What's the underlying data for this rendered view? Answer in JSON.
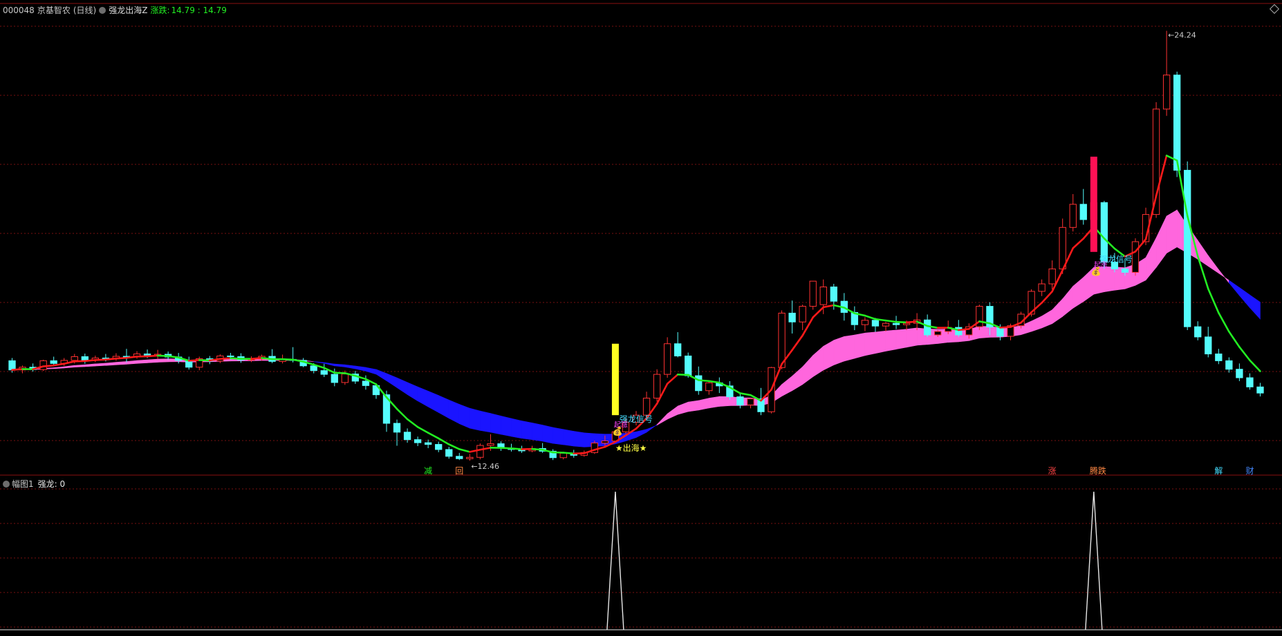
{
  "header": {
    "stock_code": "000048",
    "stock_name": "京基智农",
    "period": "(日线)",
    "indicator_name": "强龙出海Z",
    "change_label": "涨跌:",
    "change_value": "14.79 : 14.79"
  },
  "sub_panel": {
    "title": "幅图1",
    "indicator_label": "强龙: 0"
  },
  "annotations": {
    "high_price": "24.24",
    "low_price": "12.46",
    "signal_1": "强龙信号",
    "signal_2": "强龙信号",
    "tag_1": "起涨",
    "tag_2": "起涨",
    "chuhai": "★出海★",
    "bottom_tags": [
      "减",
      "回",
      "涨",
      "腾跌",
      "解",
      "财"
    ]
  },
  "colors": {
    "up": "#ff3232",
    "down": "#54fcfc",
    "ribbon_bull": "#ff66dd",
    "ribbon_bear": "#1a14ff",
    "ma_up": "#ff1a1a",
    "ma_down": "#22ee22",
    "grid": "#7a0f0f",
    "yellow_bar": "#ffff22",
    "red_bar": "#ff1155"
  },
  "chart_data": {
    "type": "candlestick",
    "x_count": 121,
    "price_range": [
      11.5,
      24.9
    ],
    "candles": [
      [
        14.7,
        14.78,
        14.43,
        14.35
      ],
      [
        14.43,
        14.56,
        14.51,
        14.33
      ],
      [
        14.51,
        14.62,
        14.44,
        14.38
      ],
      [
        14.44,
        14.73,
        14.7,
        14.4
      ],
      [
        14.7,
        14.82,
        14.62,
        14.54
      ],
      [
        14.62,
        14.78,
        14.71,
        14.55
      ],
      [
        14.71,
        14.9,
        14.82,
        14.62
      ],
      [
        14.82,
        14.91,
        14.71,
        14.61
      ],
      [
        14.71,
        14.85,
        14.78,
        14.66
      ],
      [
        14.78,
        14.9,
        14.76,
        14.68
      ],
      [
        14.76,
        14.92,
        14.83,
        14.7
      ],
      [
        14.83,
        15.05,
        14.82,
        14.65
      ],
      [
        14.82,
        14.98,
        14.9,
        14.76
      ],
      [
        14.9,
        15.03,
        14.85,
        14.78
      ],
      [
        14.85,
        15.02,
        14.89,
        14.76
      ],
      [
        14.89,
        14.97,
        14.81,
        14.72
      ],
      [
        14.81,
        14.93,
        14.71,
        14.62
      ],
      [
        14.71,
        14.82,
        14.51,
        14.44
      ],
      [
        14.51,
        14.82,
        14.76,
        14.42
      ],
      [
        14.76,
        14.84,
        14.69,
        14.6
      ],
      [
        14.69,
        14.89,
        14.84,
        14.63
      ],
      [
        14.84,
        14.93,
        14.82,
        14.73
      ],
      [
        14.82,
        14.92,
        14.72,
        14.64
      ],
      [
        14.72,
        14.83,
        14.75,
        14.66
      ],
      [
        14.75,
        14.88,
        14.83,
        14.7
      ],
      [
        14.83,
        15.04,
        14.68,
        14.63
      ],
      [
        14.68,
        14.88,
        14.74,
        14.62
      ],
      [
        14.74,
        15.1,
        14.71,
        14.65
      ],
      [
        14.71,
        14.78,
        14.55,
        14.51
      ],
      [
        14.55,
        14.63,
        14.41,
        14.33
      ],
      [
        14.41,
        14.61,
        14.3,
        14.22
      ],
      [
        14.3,
        14.47,
        14.06,
        13.95
      ],
      [
        14.06,
        14.41,
        14.31,
        13.99
      ],
      [
        14.31,
        14.4,
        14.1,
        14.02
      ],
      [
        14.1,
        14.27,
        13.97,
        13.85
      ],
      [
        13.97,
        14.04,
        13.7,
        13.58
      ],
      [
        13.7,
        13.82,
        12.86,
        12.61
      ],
      [
        12.86,
        12.97,
        12.6,
        12.2
      ],
      [
        12.6,
        12.71,
        12.38,
        12.29
      ],
      [
        12.38,
        12.47,
        12.29,
        12.19
      ],
      [
        12.29,
        12.38,
        12.24,
        12.13
      ],
      [
        12.24,
        12.32,
        12.09,
        12.01
      ],
      [
        12.09,
        12.17,
        11.89,
        11.82
      ],
      [
        11.89,
        11.99,
        11.82,
        11.78
      ],
      [
        11.82,
        11.96,
        11.86,
        11.76
      ],
      [
        11.86,
        12.27,
        12.21,
        11.8
      ],
      [
        12.21,
        12.54,
        12.26,
        12.05
      ],
      [
        12.26,
        12.33,
        12.13,
        12.05
      ],
      [
        12.13,
        12.26,
        12.09,
        12.03
      ],
      [
        12.09,
        12.2,
        12.05,
        11.99
      ],
      [
        12.05,
        12.2,
        12.12,
        12.01
      ],
      [
        12.12,
        12.28,
        12.04,
        11.99
      ],
      [
        12.04,
        12.1,
        11.85,
        11.78
      ],
      [
        11.85,
        12.02,
        11.98,
        11.8
      ],
      [
        11.98,
        12.08,
        11.92,
        11.85
      ],
      [
        11.92,
        12.06,
        12.0,
        11.88
      ],
      [
        12.0,
        12.35,
        12.28,
        11.96
      ],
      [
        12.28,
        12.5,
        12.34,
        12.2
      ],
      [
        12.34,
        12.66,
        12.61,
        12.3
      ],
      [
        12.61,
        13.0,
        12.89,
        12.55
      ],
      [
        12.89,
        13.22,
        13.1,
        12.8
      ],
      [
        13.1,
        13.79,
        13.6,
        13.0
      ],
      [
        13.6,
        14.45,
        14.3,
        13.5
      ],
      [
        14.3,
        15.39,
        15.2,
        14.2
      ],
      [
        15.2,
        15.54,
        14.84,
        14.8
      ],
      [
        14.84,
        14.94,
        14.26,
        14.2
      ],
      [
        14.26,
        14.53,
        13.82,
        13.7
      ],
      [
        13.82,
        14.1,
        14.05,
        13.7
      ],
      [
        14.05,
        14.21,
        13.96,
        13.75
      ],
      [
        13.96,
        14.1,
        13.64,
        13.55
      ],
      [
        13.64,
        13.75,
        13.4,
        13.3
      ],
      [
        13.4,
        13.6,
        13.58,
        13.3
      ],
      [
        13.58,
        13.9,
        13.2,
        13.1
      ],
      [
        13.2,
        14.52,
        14.5,
        13.15
      ],
      [
        14.5,
        16.18,
        16.1,
        14.45
      ],
      [
        16.1,
        16.47,
        15.84,
        15.5
      ],
      [
        15.84,
        16.35,
        16.3,
        15.6
      ],
      [
        16.3,
        16.65,
        17.04,
        16.2
      ],
      [
        16.35,
        17.09,
        16.87,
        16.07
      ],
      [
        16.87,
        16.96,
        16.45,
        16.2
      ],
      [
        16.45,
        16.69,
        16.12,
        15.88
      ],
      [
        16.12,
        16.3,
        15.76,
        15.6
      ],
      [
        15.76,
        15.98,
        15.89,
        15.57
      ],
      [
        15.89,
        15.96,
        15.72,
        15.55
      ],
      [
        15.72,
        15.84,
        15.8,
        15.56
      ],
      [
        15.8,
        16.02,
        15.76,
        15.63
      ],
      [
        15.76,
        15.88,
        15.8,
        15.6
      ],
      [
        15.8,
        16.1,
        15.9,
        15.6
      ],
      [
        15.9,
        16.06,
        15.46,
        15.4
      ],
      [
        15.46,
        15.6,
        15.56,
        15.4
      ],
      [
        15.56,
        15.88,
        15.68,
        15.48
      ],
      [
        15.68,
        15.9,
        15.46,
        15.4
      ],
      [
        15.46,
        15.8,
        15.7,
        15.35
      ],
      [
        15.7,
        16.35,
        16.3,
        15.6
      ],
      [
        16.3,
        16.42,
        15.69,
        15.45
      ],
      [
        15.69,
        15.77,
        15.42,
        15.3
      ],
      [
        15.42,
        15.79,
        15.73,
        15.3
      ],
      [
        15.73,
        16.14,
        16.07,
        15.65
      ],
      [
        16.07,
        16.8,
        16.74,
        16.0
      ],
      [
        16.74,
        17.09,
        16.96,
        16.6
      ],
      [
        16.96,
        17.65,
        17.4,
        16.8
      ],
      [
        17.4,
        18.88,
        18.62,
        17.25
      ],
      [
        18.62,
        19.6,
        19.3,
        18.5
      ],
      [
        19.3,
        19.75,
        18.85,
        18.7
      ],
      [
        18.85,
        19.46,
        19.35,
        18.7
      ],
      [
        19.35,
        19.4,
        17.6,
        17.4
      ],
      [
        17.6,
        17.87,
        17.4,
        17.3
      ],
      [
        17.4,
        17.7,
        17.3,
        17.2
      ],
      [
        17.3,
        18.3,
        18.2,
        17.2
      ],
      [
        18.2,
        19.2,
        19.0,
        18.1
      ],
      [
        19.0,
        22.3,
        22.1,
        18.9
      ],
      [
        22.1,
        24.4,
        23.1,
        21.9
      ],
      [
        23.1,
        23.2,
        20.3,
        20.1
      ],
      [
        20.3,
        20.56,
        15.7,
        15.6
      ],
      [
        15.7,
        15.86,
        15.4,
        15.3
      ],
      [
        15.4,
        15.7,
        14.9,
        14.8
      ],
      [
        14.9,
        15.05,
        14.7,
        14.6
      ],
      [
        14.7,
        14.8,
        14.45,
        14.35
      ],
      [
        14.45,
        14.62,
        14.2,
        14.1
      ],
      [
        14.2,
        14.33,
        13.93,
        13.85
      ],
      [
        13.93,
        14.05,
        13.75,
        13.65
      ]
    ]
  }
}
